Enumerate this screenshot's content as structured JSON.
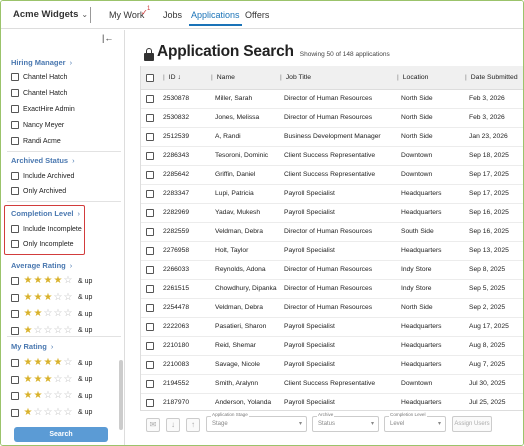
{
  "topnav": {
    "brand": "Acme Widgets",
    "brand_chevron": "⌄",
    "nav_items": [
      {
        "label": "My Work",
        "badge": "1",
        "active": false
      },
      {
        "label": "Jobs",
        "active": false
      },
      {
        "label": "Applications",
        "active": true
      },
      {
        "label": "Offers",
        "active": false
      }
    ]
  },
  "sidebar": {
    "collapse_icon": "collapse-left-icon",
    "sections": {
      "hiring_manager": {
        "title": "Hiring Manager",
        "items": [
          "Chantel Hatch",
          "Chantel Hatch",
          "ExactHire Admin",
          "Nancy Meyer",
          "Randi Acme"
        ]
      },
      "archived_status": {
        "title": "Archived Status",
        "items": [
          "Include Archived",
          "Only Archived"
        ]
      },
      "completion_level": {
        "title": "Completion Level",
        "items": [
          "Include Incomplete",
          "Only Incomplete"
        ]
      },
      "average_rating": {
        "title": "Average Rating",
        "ratings": [
          4,
          3,
          2,
          1
        ],
        "suffix": "& up"
      },
      "my_rating": {
        "title": "My Rating",
        "ratings": [
          4,
          3,
          2,
          1
        ],
        "suffix": "& up"
      }
    },
    "search_button": "Search"
  },
  "main": {
    "title": "Application Search",
    "showing": "Showing 50 of 148 applications",
    "columns": [
      "ID",
      "Name",
      "Job Title",
      "Location",
      "Date Submitted"
    ],
    "rows": [
      {
        "id": "2530878",
        "name": "Miller, Sarah",
        "job": "Director of Human Resources",
        "location": "North Side",
        "date": "Feb 3, 2026"
      },
      {
        "id": "2530832",
        "name": "Jones, Melissa",
        "job": "Director of Human Resources",
        "location": "North Side",
        "date": "Feb 3, 2026"
      },
      {
        "id": "2512539",
        "name": "A, Randi",
        "job": "Business Development Manager",
        "location": "North Side",
        "date": "Jan 23, 2026"
      },
      {
        "id": "2286343",
        "name": "Tesoroni, Dominic",
        "job": "Client Success Representative",
        "location": "Downtown",
        "date": "Sep 18, 2025"
      },
      {
        "id": "2285642",
        "name": "Griffin, Daniel",
        "job": "Client Success Representative",
        "location": "Downtown",
        "date": "Sep 17, 2025"
      },
      {
        "id": "2283347",
        "name": "Lupi, Patricia",
        "job": "Payroll Specialist",
        "location": "Headquarters",
        "date": "Sep 17, 2025"
      },
      {
        "id": "2282969",
        "name": "Yadav, Mukesh",
        "job": "Payroll Specialist",
        "location": "Headquarters",
        "date": "Sep 16, 2025"
      },
      {
        "id": "2282559",
        "name": "Veldman, Debra",
        "job": "Director of Human Resources",
        "location": "South Side",
        "date": "Sep 16, 2025"
      },
      {
        "id": "2276958",
        "name": "Holt, Taylor",
        "job": "Payroll Specialist",
        "location": "Headquarters",
        "date": "Sep 13, 2025"
      },
      {
        "id": "2266033",
        "name": "Reynolds, Adona",
        "job": "Director of Human Resources",
        "location": "Indy Store",
        "date": "Sep 8, 2025"
      },
      {
        "id": "2261515",
        "name": "Chowdhury, Dipanka",
        "job": "Director of Human Resources",
        "location": "Indy Store",
        "date": "Sep 5, 2025"
      },
      {
        "id": "2254478",
        "name": "Veldman, Debra",
        "job": "Director of Human Resources",
        "location": "North Side",
        "date": "Sep 2, 2025"
      },
      {
        "id": "2222063",
        "name": "Pasatieri, Sharon",
        "job": "Payroll Specialist",
        "location": "Headquarters",
        "date": "Aug 17, 2025"
      },
      {
        "id": "2210180",
        "name": "Reid, Shemar",
        "job": "Payroll Specialist",
        "location": "Headquarters",
        "date": "Aug 8, 2025"
      },
      {
        "id": "2210083",
        "name": "Savage, Nicole",
        "job": "Payroll Specialist",
        "location": "Headquarters",
        "date": "Aug 7, 2025"
      },
      {
        "id": "2194552",
        "name": "Smith, Aralynn",
        "job": "Client Success Representative",
        "location": "Downtown",
        "date": "Jul 30, 2025"
      },
      {
        "id": "2187970",
        "name": "Anderson, Yolanda",
        "job": "Payroll Specialist",
        "location": "Headquarters",
        "date": "Jul 25, 2025"
      }
    ],
    "footer": {
      "application_stage": {
        "label": "Application Stage",
        "value": "Stage"
      },
      "archive": {
        "label": "Archive",
        "value": "Status"
      },
      "completion_level": {
        "label": "Completion Level",
        "value": "Level"
      },
      "assign_users": "Assign Users"
    }
  },
  "colors": {
    "accent": "#1a73b8",
    "highlight_box": "#d23c3c",
    "search_button": "#5b9bd5",
    "star": "#d9b22b"
  }
}
